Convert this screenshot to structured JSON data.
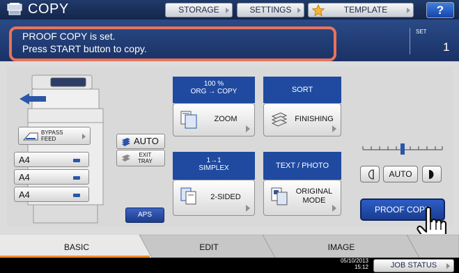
{
  "header": {
    "title": "COPY",
    "storage_label": "STORAGE",
    "settings_label": "SETTINGS",
    "template_label": "TEMPLATE",
    "help_label": "?"
  },
  "message": {
    "line1": "PROOF COPY is set.",
    "line2": "Press START button to copy.",
    "set_label": "SET",
    "set_value": "1"
  },
  "paper": {
    "bypass_label_1": "BYPASS",
    "bypass_label_2": "FEED",
    "auto_label": "AUTO",
    "exit_tray_label_1": "EXIT",
    "exit_tray_label_2": "TRAY",
    "trays": [
      "A4",
      "A4",
      "A4"
    ],
    "aps_label": "APS"
  },
  "zoom": {
    "ratio": "100 %",
    "mode": "ORG  →  COPY",
    "button_label": "ZOOM"
  },
  "finishing": {
    "header": "SORT",
    "button_label": "FINISHING"
  },
  "sided": {
    "header_line1": "1→1",
    "header_line2": "SIMPLEX",
    "button_label": "2-SIDED"
  },
  "original_mode": {
    "header": "TEXT / PHOTO",
    "button_line1": "ORIGINAL",
    "button_line2": "MODE"
  },
  "density": {
    "auto_label": "AUTO",
    "level_fraction": 0.5
  },
  "proof_copy_label": "PROOF COPY",
  "tabs": {
    "basic": "BASIC",
    "edit": "EDIT",
    "image": "IMAGE"
  },
  "status": {
    "date": "05/10/2013",
    "time": "15:12",
    "job_status_label": "JOB STATUS"
  },
  "colors": {
    "accent_blue": "#1f4aa0",
    "highlight_outline": "#e8735a",
    "active_tab_line": "#f08a2a"
  }
}
